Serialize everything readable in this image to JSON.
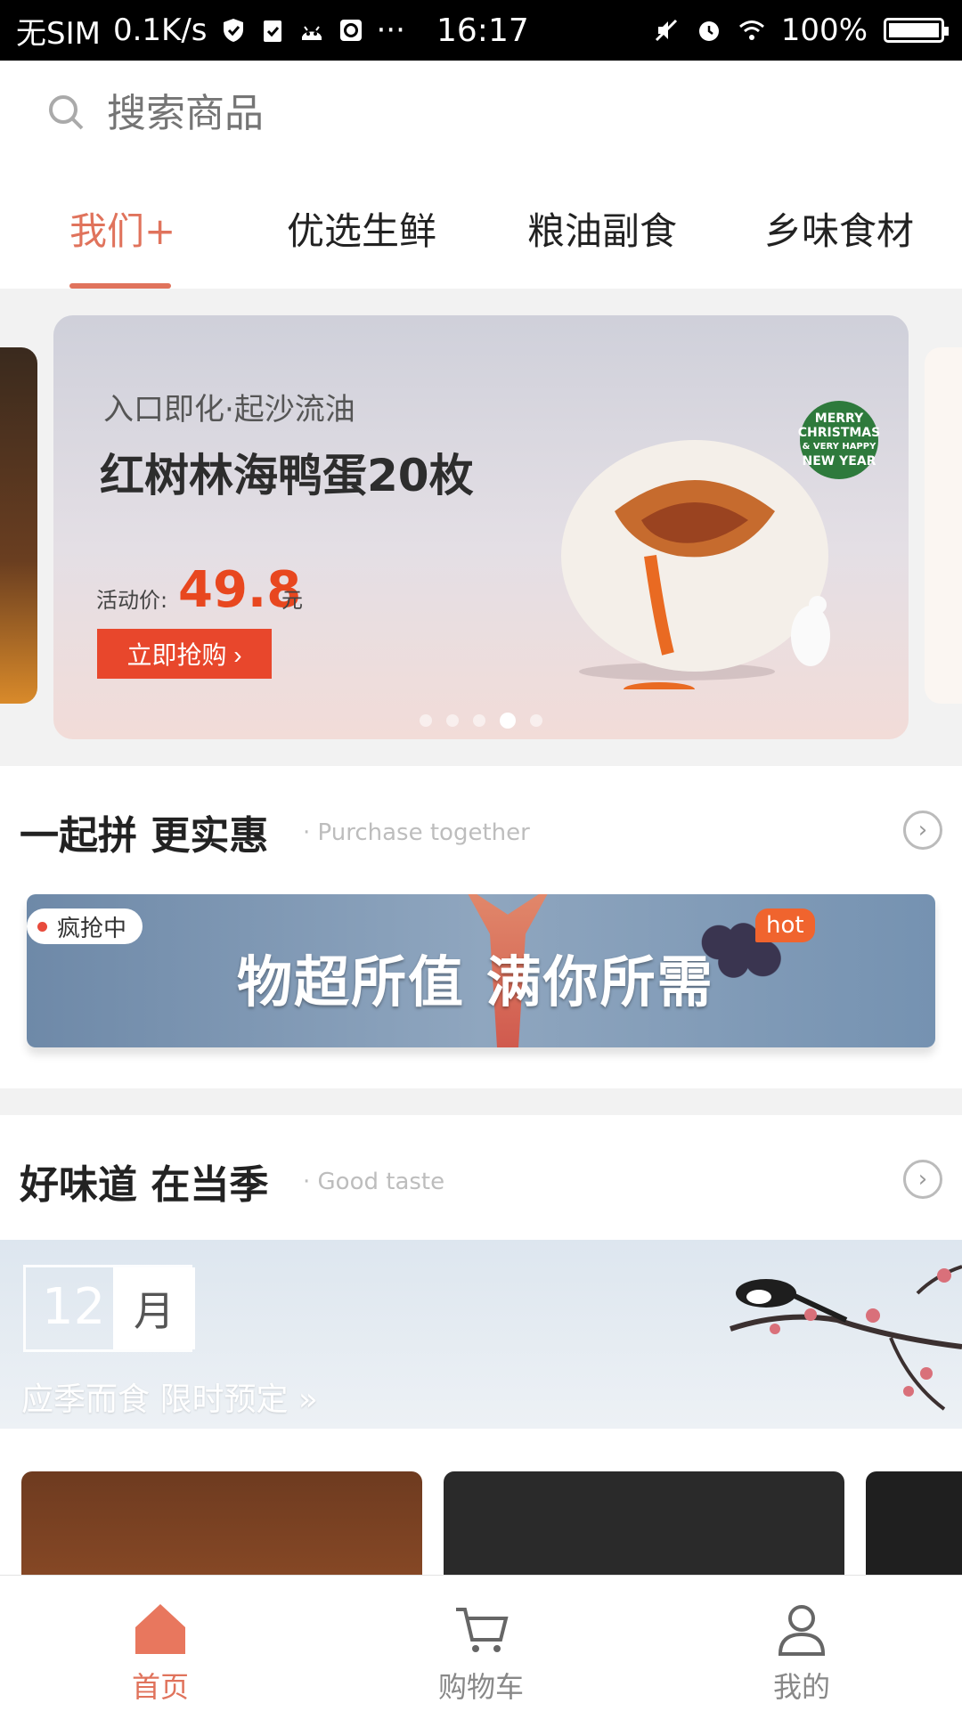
{
  "status_bar": {
    "carrier": "无SIM",
    "speed": "0.1K/s",
    "more": "···",
    "time": "16:17",
    "battery": "100%"
  },
  "search": {
    "placeholder": "搜索商品"
  },
  "tabs": [
    {
      "label": "我们+",
      "active": true
    },
    {
      "label": "优选生鲜",
      "active": false
    },
    {
      "label": "粮油副食",
      "active": false
    },
    {
      "label": "乡味食材",
      "active": false
    }
  ],
  "banner": {
    "subtitle": "入口即化·起沙流油",
    "title": "红树林海鸭蛋20枚",
    "price_label": "活动价:",
    "price": "49.8",
    "unit": "元",
    "button": "立即抢购 ›",
    "badge_lines": [
      "MERRY",
      "CHRISTMAS",
      "& VERY HAPPY",
      "NEW YEAR"
    ],
    "dots_total": 5,
    "dots_active": 4
  },
  "section_group": {
    "title": "一起拼 更实惠",
    "subtitle_en": "· Purchase together",
    "badge": "疯抢中",
    "hot": "hot",
    "banner_text": "物超所值 满你所需"
  },
  "section_season": {
    "title": "好味道 在当季",
    "subtitle_en": "· Good taste",
    "month_num": "12",
    "month_label": "月",
    "tagline": "应季而食 限时预定 »"
  },
  "bottom_nav": [
    {
      "label": "首页",
      "icon": "home-icon",
      "active": true
    },
    {
      "label": "购物车",
      "icon": "cart-icon",
      "active": false
    },
    {
      "label": "我的",
      "icon": "user-icon",
      "active": false
    }
  ],
  "colors": {
    "accent": "#e0735c",
    "price": "#e8471f",
    "button": "#e8472c"
  }
}
